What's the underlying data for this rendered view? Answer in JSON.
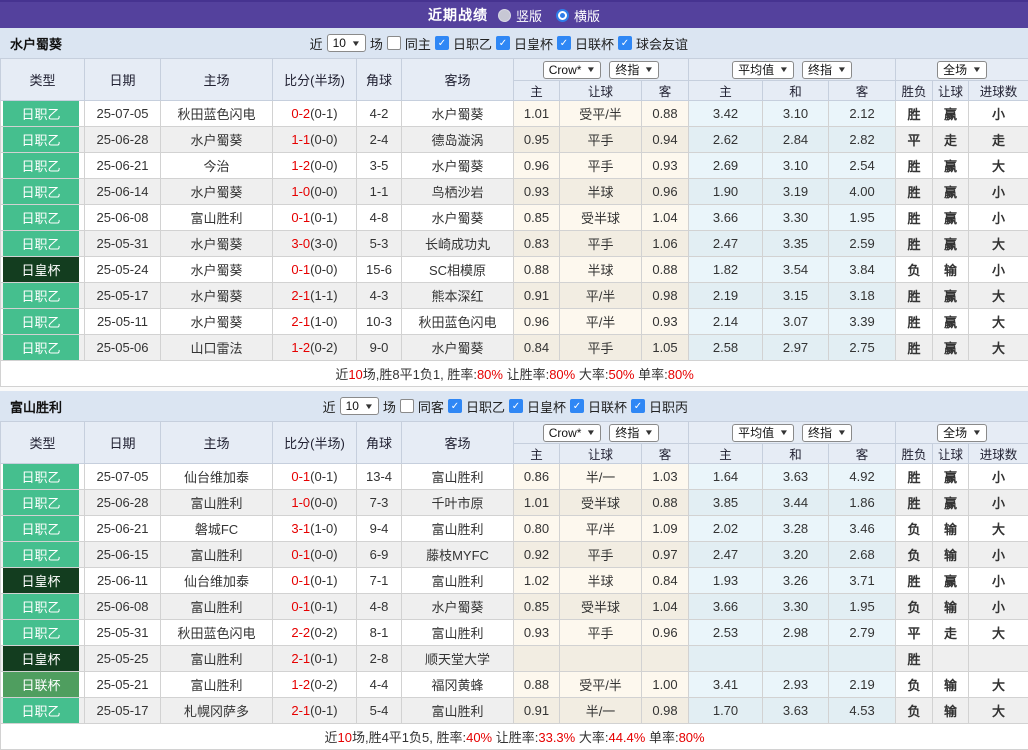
{
  "topbar": {
    "title": "近期战绩",
    "radios": [
      {
        "label": "竖版",
        "selected": false
      },
      {
        "label": "横版",
        "selected": true
      }
    ]
  },
  "table_header": {
    "cols": [
      "类型",
      "日期",
      "主场",
      "比分(半场)",
      "角球",
      "客场"
    ],
    "odds_sub": [
      "主",
      "让球",
      "客"
    ],
    "avg_sub": [
      "主",
      "和",
      "客"
    ],
    "result_sub": [
      "胜负",
      "让球",
      "进球数"
    ],
    "selects": {
      "bookmaker": "Crow*",
      "odds_time": "终指",
      "average": "平均值",
      "avg_time": "终指",
      "scope": "全场"
    }
  },
  "type_styles": {
    "日职乙": "ljy",
    "日皇杯": "cup",
    "日联杯": "lc",
    "日职丙": "ljy",
    "球会友谊": "ljy"
  },
  "result_colors": {
    "胜": "r",
    "赢": "r",
    "大": "r",
    "负": "b",
    "输": "b",
    "小": "b",
    "平": "g",
    "走": "g"
  },
  "colors": {
    "topbar_purple": "#54419d",
    "league_j2_green": "#45bf8e",
    "emperor_cup_dark_green": "#133d1f",
    "league_cup_green": "#4f9e5f",
    "highlight_team_green": "#2aa52a",
    "score_red": "#e60000",
    "win_red": "#da3333",
    "lose_blue": "#3c3ccc",
    "draw_green": "#2f9e2f"
  },
  "sections": [
    {
      "team": "水户蜀葵",
      "filters": {
        "near_label": "近",
        "count": "10",
        "unit_label": "场",
        "same": {
          "label": "同主",
          "checked": false
        },
        "leagues": [
          {
            "label": "日职乙",
            "checked": true
          },
          {
            "label": "日皇杯",
            "checked": true
          },
          {
            "label": "日联杯",
            "checked": true
          },
          {
            "label": "球会友谊",
            "checked": true
          }
        ]
      },
      "rows": [
        {
          "type": "日职乙",
          "date": "25-07-05",
          "home": "秋田蓝色闪电",
          "home_hl": false,
          "ft": "0-2",
          "ht": "(0-1)",
          "corners": "4-2",
          "away": "水户蜀葵",
          "away_hl": true,
          "odds": [
            "1.01",
            "受平/半",
            "0.88"
          ],
          "avg": [
            "3.42",
            "3.10",
            "2.12"
          ],
          "results": [
            "胜",
            "赢",
            "小"
          ]
        },
        {
          "type": "日职乙",
          "date": "25-06-28",
          "home": "水户蜀葵",
          "home_hl": true,
          "ft": "1-1",
          "ht": "(0-0)",
          "corners": "2-4",
          "away": "德岛漩涡",
          "away_hl": false,
          "odds": [
            "0.95",
            "平手",
            "0.94"
          ],
          "avg": [
            "2.62",
            "2.84",
            "2.82"
          ],
          "results": [
            "平",
            "走",
            "走"
          ]
        },
        {
          "type": "日职乙",
          "date": "25-06-21",
          "home": "今治",
          "home_hl": false,
          "ft": "1-2",
          "ht": "(0-0)",
          "corners": "3-5",
          "away": "水户蜀葵",
          "away_hl": true,
          "odds": [
            "0.96",
            "平手",
            "0.93"
          ],
          "avg": [
            "2.69",
            "3.10",
            "2.54"
          ],
          "results": [
            "胜",
            "赢",
            "大"
          ]
        },
        {
          "type": "日职乙",
          "date": "25-06-14",
          "home": "水户蜀葵",
          "home_hl": true,
          "ft": "1-0",
          "ht": "(0-0)",
          "corners": "1-1",
          "away": "鸟栖沙岩",
          "away_hl": false,
          "odds": [
            "0.93",
            "半球",
            "0.96"
          ],
          "avg": [
            "1.90",
            "3.19",
            "4.00"
          ],
          "results": [
            "胜",
            "赢",
            "小"
          ]
        },
        {
          "type": "日职乙",
          "date": "25-06-08",
          "home": "富山胜利",
          "home_hl": false,
          "ft": "0-1",
          "ht": "(0-1)",
          "corners": "4-8",
          "away": "水户蜀葵",
          "away_hl": true,
          "odds": [
            "0.85",
            "受半球",
            "1.04"
          ],
          "avg": [
            "3.66",
            "3.30",
            "1.95"
          ],
          "results": [
            "胜",
            "赢",
            "小"
          ]
        },
        {
          "type": "日职乙",
          "date": "25-05-31",
          "home": "水户蜀葵",
          "home_hl": true,
          "ft": "3-0",
          "ht": "(3-0)",
          "corners": "5-3",
          "away": "长崎成功丸",
          "away_hl": false,
          "odds": [
            "0.83",
            "平手",
            "1.06"
          ],
          "avg": [
            "2.47",
            "3.35",
            "2.59"
          ],
          "results": [
            "胜",
            "赢",
            "大"
          ]
        },
        {
          "type": "日皇杯",
          "date": "25-05-24",
          "home": "水户蜀葵",
          "home_hl": true,
          "ft": "0-1",
          "ht": "(0-0)",
          "corners": "15-6",
          "away": "SC相模原",
          "away_hl": false,
          "odds": [
            "0.88",
            "半球",
            "0.88"
          ],
          "avg": [
            "1.82",
            "3.54",
            "3.84"
          ],
          "results": [
            "负",
            "输",
            "小"
          ]
        },
        {
          "type": "日职乙",
          "date": "25-05-17",
          "home": "水户蜀葵",
          "home_hl": true,
          "ft": "2-1",
          "ht": "(1-1)",
          "corners": "4-3",
          "away": "熊本深红",
          "away_hl": false,
          "odds": [
            "0.91",
            "平/半",
            "0.98"
          ],
          "avg": [
            "2.19",
            "3.15",
            "3.18"
          ],
          "results": [
            "胜",
            "赢",
            "大"
          ]
        },
        {
          "type": "日职乙",
          "date": "25-05-11",
          "home": "水户蜀葵",
          "home_hl": true,
          "ft": "2-1",
          "ht": "(1-0)",
          "corners": "10-3",
          "away": "秋田蓝色闪电",
          "away_hl": false,
          "odds": [
            "0.96",
            "平/半",
            "0.93"
          ],
          "avg": [
            "2.14",
            "3.07",
            "3.39"
          ],
          "results": [
            "胜",
            "赢",
            "大"
          ]
        },
        {
          "type": "日职乙",
          "date": "25-05-06",
          "home": "山口雷法",
          "home_hl": false,
          "ft": "1-2",
          "ht": "(0-2)",
          "corners": "9-0",
          "away": "水户蜀葵",
          "away_hl": true,
          "odds": [
            "0.84",
            "平手",
            "1.05"
          ],
          "avg": [
            "2.58",
            "2.97",
            "2.75"
          ],
          "results": [
            "胜",
            "赢",
            "大"
          ]
        }
      ],
      "summary": [
        {
          "t": "近"
        },
        {
          "t": "10",
          "red": true
        },
        {
          "t": "场,胜8平1负1, 胜率:"
        },
        {
          "t": "80%",
          "red": true
        },
        {
          "t": " 让胜率:"
        },
        {
          "t": "80%",
          "red": true
        },
        {
          "t": " 大率:"
        },
        {
          "t": "50%",
          "red": true
        },
        {
          "t": " 单率:"
        },
        {
          "t": "80%",
          "red": true
        }
      ]
    },
    {
      "team": "富山胜利",
      "filters": {
        "near_label": "近",
        "count": "10",
        "unit_label": "场",
        "same": {
          "label": "同客",
          "checked": false
        },
        "leagues": [
          {
            "label": "日职乙",
            "checked": true
          },
          {
            "label": "日皇杯",
            "checked": true
          },
          {
            "label": "日联杯",
            "checked": true
          },
          {
            "label": "日职丙",
            "checked": true
          }
        ]
      },
      "rows": [
        {
          "type": "日职乙",
          "date": "25-07-05",
          "home": "仙台维加泰",
          "home_hl": false,
          "ft": "0-1",
          "ht": "(0-1)",
          "corners": "13-4",
          "away": "富山胜利",
          "away_hl": true,
          "odds": [
            "0.86",
            "半/一",
            "1.03"
          ],
          "avg": [
            "1.64",
            "3.63",
            "4.92"
          ],
          "results": [
            "胜",
            "赢",
            "小"
          ]
        },
        {
          "type": "日职乙",
          "date": "25-06-28",
          "home": "富山胜利",
          "home_hl": true,
          "ft": "1-0",
          "ht": "(0-0)",
          "corners": "7-3",
          "away": "千叶市原",
          "away_hl": false,
          "odds": [
            "1.01",
            "受半球",
            "0.88"
          ],
          "avg": [
            "3.85",
            "3.44",
            "1.86"
          ],
          "results": [
            "胜",
            "赢",
            "小"
          ]
        },
        {
          "type": "日职乙",
          "date": "25-06-21",
          "home": "磐城FC",
          "home_hl": false,
          "ft": "3-1",
          "ht": "(1-0)",
          "corners": "9-4",
          "away": "富山胜利",
          "away_hl": true,
          "odds": [
            "0.80",
            "平/半",
            "1.09"
          ],
          "avg": [
            "2.02",
            "3.28",
            "3.46"
          ],
          "results": [
            "负",
            "输",
            "大"
          ]
        },
        {
          "type": "日职乙",
          "date": "25-06-15",
          "home": "富山胜利",
          "home_hl": true,
          "ft": "0-1",
          "ht": "(0-0)",
          "corners": "6-9",
          "away": "藤枝MYFC",
          "away_hl": false,
          "odds": [
            "0.92",
            "平手",
            "0.97"
          ],
          "avg": [
            "2.47",
            "3.20",
            "2.68"
          ],
          "results": [
            "负",
            "输",
            "小"
          ]
        },
        {
          "type": "日皇杯",
          "date": "25-06-11",
          "home": "仙台维加泰",
          "home_hl": false,
          "ft": "0-1",
          "ht": "(0-1)",
          "corners": "7-1",
          "away": "富山胜利",
          "away_hl": true,
          "odds": [
            "1.02",
            "半球",
            "0.84"
          ],
          "avg": [
            "1.93",
            "3.26",
            "3.71"
          ],
          "results": [
            "胜",
            "赢",
            "小"
          ]
        },
        {
          "type": "日职乙",
          "date": "25-06-08",
          "home": "富山胜利",
          "home_hl": true,
          "ft": "0-1",
          "ht": "(0-1)",
          "corners": "4-8",
          "away": "水户蜀葵",
          "away_hl": false,
          "odds": [
            "0.85",
            "受半球",
            "1.04"
          ],
          "avg": [
            "3.66",
            "3.30",
            "1.95"
          ],
          "results": [
            "负",
            "输",
            "小"
          ]
        },
        {
          "type": "日职乙",
          "date": "25-05-31",
          "home": "秋田蓝色闪电",
          "home_hl": false,
          "ft": "2-2",
          "ht": "(0-2)",
          "corners": "8-1",
          "away": "富山胜利",
          "away_hl": true,
          "odds": [
            "0.93",
            "平手",
            "0.96"
          ],
          "avg": [
            "2.53",
            "2.98",
            "2.79"
          ],
          "results": [
            "平",
            "走",
            "大"
          ]
        },
        {
          "type": "日皇杯",
          "date": "25-05-25",
          "home": "富山胜利",
          "home_hl": true,
          "ft": "2-1",
          "ht": "(0-1)",
          "corners": "2-8",
          "away": "顺天堂大学",
          "away_hl": false,
          "odds": [
            "",
            "",
            ""
          ],
          "avg": [
            "",
            "",
            ""
          ],
          "results": [
            "胜",
            "",
            ""
          ]
        },
        {
          "type": "日联杯",
          "date": "25-05-21",
          "home": "富山胜利",
          "home_hl": true,
          "ft": "1-2",
          "ht": "(0-2)",
          "corners": "4-4",
          "away": "福冈黄蜂",
          "away_hl": false,
          "odds": [
            "0.88",
            "受平/半",
            "1.00"
          ],
          "avg": [
            "3.41",
            "2.93",
            "2.19"
          ],
          "results": [
            "负",
            "输",
            "大"
          ]
        },
        {
          "type": "日职乙",
          "date": "25-05-17",
          "home": "札幌冈萨多",
          "home_hl": false,
          "ft": "2-1",
          "ht": "(0-1)",
          "corners": "5-4",
          "away": "富山胜利",
          "away_hl": true,
          "odds": [
            "0.91",
            "半/一",
            "0.98"
          ],
          "avg": [
            "1.70",
            "3.63",
            "4.53"
          ],
          "results": [
            "负",
            "输",
            "大"
          ]
        }
      ],
      "summary": [
        {
          "t": "近"
        },
        {
          "t": "10",
          "red": true
        },
        {
          "t": "场,胜4平1负5, 胜率:"
        },
        {
          "t": "40%",
          "red": true
        },
        {
          "t": " 让胜率:"
        },
        {
          "t": "33.3%",
          "red": true
        },
        {
          "t": " 大率:"
        },
        {
          "t": "44.4%",
          "red": true
        },
        {
          "t": " 单率:"
        },
        {
          "t": "80%",
          "red": true
        }
      ]
    }
  ]
}
